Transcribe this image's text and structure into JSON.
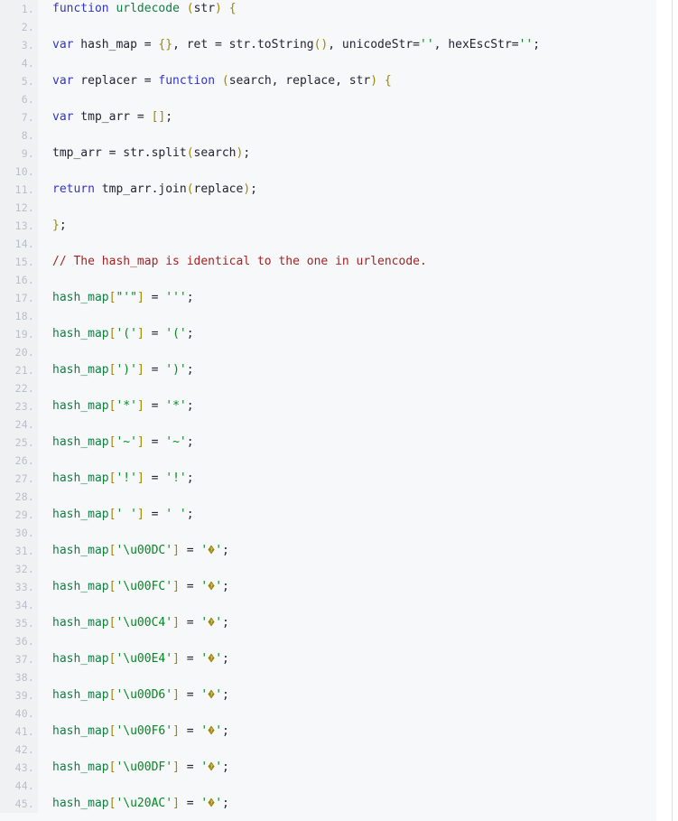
{
  "viewer": {
    "language": "javascript",
    "first_line": 1,
    "last_line": 45,
    "line_number_suffix": ".",
    "colors": {
      "gutter_background": "#f0f1f3",
      "gutter_text": "#b8bfcc",
      "code_background": "#f7f8fa",
      "plain_text": "#232333",
      "keyword": "#3333cc",
      "string": "#008a1f",
      "identifier": "#0f8040",
      "bracket": "#9b8800",
      "comment": "#a52222",
      "scrollbar_border": "#dcdcdc"
    }
  },
  "code": {
    "lines": [
      {
        "n": "1.",
        "tokens": [
          {
            "t": "kw",
            "v": "function"
          },
          {
            "t": "pl",
            "v": " "
          },
          {
            "t": "id",
            "v": "urldecode"
          },
          {
            "t": "pl",
            "v": " "
          },
          {
            "t": "brk",
            "v": "("
          },
          {
            "t": "pl",
            "v": "str"
          },
          {
            "t": "brk",
            "v": ")"
          },
          {
            "t": "pl",
            "v": " "
          },
          {
            "t": "brk",
            "v": "{"
          }
        ]
      },
      {
        "n": "2.",
        "tokens": []
      },
      {
        "n": "3.",
        "tokens": [
          {
            "t": "kw",
            "v": "var"
          },
          {
            "t": "pl",
            "v": " hash_map = "
          },
          {
            "t": "brk",
            "v": "{}"
          },
          {
            "t": "pl",
            "v": ", ret = str.toString"
          },
          {
            "t": "brk",
            "v": "()"
          },
          {
            "t": "pl",
            "v": ", unicodeStr="
          },
          {
            "t": "str",
            "v": "''"
          },
          {
            "t": "pl",
            "v": ", hexEscStr="
          },
          {
            "t": "str",
            "v": "''"
          },
          {
            "t": "pl",
            "v": ";"
          }
        ]
      },
      {
        "n": "4.",
        "tokens": []
      },
      {
        "n": "5.",
        "tokens": [
          {
            "t": "kw",
            "v": "var"
          },
          {
            "t": "pl",
            "v": " replacer = "
          },
          {
            "t": "kw",
            "v": "function"
          },
          {
            "t": "pl",
            "v": " "
          },
          {
            "t": "brk",
            "v": "("
          },
          {
            "t": "pl",
            "v": "search, replace, str"
          },
          {
            "t": "brk",
            "v": ")"
          },
          {
            "t": "pl",
            "v": " "
          },
          {
            "t": "brk",
            "v": "{"
          }
        ]
      },
      {
        "n": "6.",
        "tokens": []
      },
      {
        "n": "7.",
        "tokens": [
          {
            "t": "kw",
            "v": "var"
          },
          {
            "t": "pl",
            "v": " tmp_arr = "
          },
          {
            "t": "brk",
            "v": "[]"
          },
          {
            "t": "pl",
            "v": ";"
          }
        ]
      },
      {
        "n": "8.",
        "tokens": []
      },
      {
        "n": "9.",
        "tokens": [
          {
            "t": "pl",
            "v": "tmp_arr = str.split"
          },
          {
            "t": "brk",
            "v": "("
          },
          {
            "t": "pl",
            "v": "search"
          },
          {
            "t": "brk",
            "v": ")"
          },
          {
            "t": "pl",
            "v": ";"
          }
        ]
      },
      {
        "n": "10.",
        "tokens": []
      },
      {
        "n": "11.",
        "tokens": [
          {
            "t": "kw",
            "v": "return"
          },
          {
            "t": "pl",
            "v": " tmp_arr.join"
          },
          {
            "t": "brk",
            "v": "("
          },
          {
            "t": "pl",
            "v": "replace"
          },
          {
            "t": "brk",
            "v": ")"
          },
          {
            "t": "pl",
            "v": ";"
          }
        ]
      },
      {
        "n": "12.",
        "tokens": []
      },
      {
        "n": "13.",
        "tokens": [
          {
            "t": "brk",
            "v": "}"
          },
          {
            "t": "pl",
            "v": ";"
          }
        ]
      },
      {
        "n": "14.",
        "tokens": []
      },
      {
        "n": "15.",
        "tokens": [
          {
            "t": "com",
            "v": "// The hash_map is identical to the one in urlencode."
          }
        ]
      },
      {
        "n": "16.",
        "tokens": []
      },
      {
        "n": "17.",
        "tokens": [
          {
            "t": "id",
            "v": "hash_map"
          },
          {
            "t": "brk",
            "v": "["
          },
          {
            "t": "str",
            "v": "\"'\""
          },
          {
            "t": "brk",
            "v": "]"
          },
          {
            "t": "pl",
            "v": " = "
          },
          {
            "t": "str",
            "v": "'''"
          },
          {
            "t": "pl",
            "v": ";"
          }
        ]
      },
      {
        "n": "18.",
        "tokens": []
      },
      {
        "n": "19.",
        "tokens": [
          {
            "t": "id",
            "v": "hash_map"
          },
          {
            "t": "brk",
            "v": "["
          },
          {
            "t": "str",
            "v": "'('"
          },
          {
            "t": "brk",
            "v": "]"
          },
          {
            "t": "pl",
            "v": " = "
          },
          {
            "t": "str",
            "v": "'('"
          },
          {
            "t": "pl",
            "v": ";"
          }
        ]
      },
      {
        "n": "20.",
        "tokens": []
      },
      {
        "n": "21.",
        "tokens": [
          {
            "t": "id",
            "v": "hash_map"
          },
          {
            "t": "brk",
            "v": "["
          },
          {
            "t": "str",
            "v": "')'"
          },
          {
            "t": "brk",
            "v": "]"
          },
          {
            "t": "pl",
            "v": " = "
          },
          {
            "t": "str",
            "v": "')'"
          },
          {
            "t": "pl",
            "v": ";"
          }
        ]
      },
      {
        "n": "22.",
        "tokens": []
      },
      {
        "n": "23.",
        "tokens": [
          {
            "t": "id",
            "v": "hash_map"
          },
          {
            "t": "brk",
            "v": "["
          },
          {
            "t": "str",
            "v": "'*'"
          },
          {
            "t": "brk",
            "v": "]"
          },
          {
            "t": "pl",
            "v": " = "
          },
          {
            "t": "str",
            "v": "'*'"
          },
          {
            "t": "pl",
            "v": ";"
          }
        ]
      },
      {
        "n": "24.",
        "tokens": []
      },
      {
        "n": "25.",
        "tokens": [
          {
            "t": "id",
            "v": "hash_map"
          },
          {
            "t": "brk",
            "v": "["
          },
          {
            "t": "str",
            "v": "'~'"
          },
          {
            "t": "brk",
            "v": "]"
          },
          {
            "t": "pl",
            "v": " = "
          },
          {
            "t": "str",
            "v": "'~'"
          },
          {
            "t": "pl",
            "v": ";"
          }
        ]
      },
      {
        "n": "26.",
        "tokens": []
      },
      {
        "n": "27.",
        "tokens": [
          {
            "t": "id",
            "v": "hash_map"
          },
          {
            "t": "brk",
            "v": "["
          },
          {
            "t": "str",
            "v": "'!'"
          },
          {
            "t": "brk",
            "v": "]"
          },
          {
            "t": "pl",
            "v": " = "
          },
          {
            "t": "str",
            "v": "'!'"
          },
          {
            "t": "pl",
            "v": ";"
          }
        ]
      },
      {
        "n": "28.",
        "tokens": []
      },
      {
        "n": "29.",
        "tokens": [
          {
            "t": "id",
            "v": "hash_map"
          },
          {
            "t": "brk",
            "v": "["
          },
          {
            "t": "str",
            "v": "' '"
          },
          {
            "t": "brk",
            "v": "]"
          },
          {
            "t": "pl",
            "v": " = "
          },
          {
            "t": "str",
            "v": "' '"
          },
          {
            "t": "pl",
            "v": ";"
          }
        ]
      },
      {
        "n": "30.",
        "tokens": []
      },
      {
        "n": "31.",
        "tokens": [
          {
            "t": "id",
            "v": "hash_map"
          },
          {
            "t": "brk",
            "v": "["
          },
          {
            "t": "str",
            "v": "'\\u00DC'"
          },
          {
            "t": "brk",
            "v": "]"
          },
          {
            "t": "pl",
            "v": " = "
          },
          {
            "t": "str",
            "v": "'"
          },
          {
            "t": "repl",
            "v": "�"
          },
          {
            "t": "str",
            "v": "'"
          },
          {
            "t": "pl",
            "v": ";"
          }
        ]
      },
      {
        "n": "32.",
        "tokens": []
      },
      {
        "n": "33.",
        "tokens": [
          {
            "t": "id",
            "v": "hash_map"
          },
          {
            "t": "brk",
            "v": "["
          },
          {
            "t": "str",
            "v": "'\\u00FC'"
          },
          {
            "t": "brk",
            "v": "]"
          },
          {
            "t": "pl",
            "v": " = "
          },
          {
            "t": "str",
            "v": "'"
          },
          {
            "t": "repl",
            "v": "�"
          },
          {
            "t": "str",
            "v": "'"
          },
          {
            "t": "pl",
            "v": ";"
          }
        ]
      },
      {
        "n": "34.",
        "tokens": []
      },
      {
        "n": "35.",
        "tokens": [
          {
            "t": "id",
            "v": "hash_map"
          },
          {
            "t": "brk",
            "v": "["
          },
          {
            "t": "str",
            "v": "'\\u00C4'"
          },
          {
            "t": "brk",
            "v": "]"
          },
          {
            "t": "pl",
            "v": " = "
          },
          {
            "t": "str",
            "v": "'"
          },
          {
            "t": "repl",
            "v": "�"
          },
          {
            "t": "str",
            "v": "'"
          },
          {
            "t": "pl",
            "v": ";"
          }
        ]
      },
      {
        "n": "36.",
        "tokens": []
      },
      {
        "n": "37.",
        "tokens": [
          {
            "t": "id",
            "v": "hash_map"
          },
          {
            "t": "brk",
            "v": "["
          },
          {
            "t": "str",
            "v": "'\\u00E4'"
          },
          {
            "t": "brk",
            "v": "]"
          },
          {
            "t": "pl",
            "v": " = "
          },
          {
            "t": "str",
            "v": "'"
          },
          {
            "t": "repl",
            "v": "�"
          },
          {
            "t": "str",
            "v": "'"
          },
          {
            "t": "pl",
            "v": ";"
          }
        ]
      },
      {
        "n": "38.",
        "tokens": []
      },
      {
        "n": "39.",
        "tokens": [
          {
            "t": "id",
            "v": "hash_map"
          },
          {
            "t": "brk",
            "v": "["
          },
          {
            "t": "str",
            "v": "'\\u00D6'"
          },
          {
            "t": "brk",
            "v": "]"
          },
          {
            "t": "pl",
            "v": " = "
          },
          {
            "t": "str",
            "v": "'"
          },
          {
            "t": "repl",
            "v": "�"
          },
          {
            "t": "str",
            "v": "'"
          },
          {
            "t": "pl",
            "v": ";"
          }
        ]
      },
      {
        "n": "40.",
        "tokens": []
      },
      {
        "n": "41.",
        "tokens": [
          {
            "t": "id",
            "v": "hash_map"
          },
          {
            "t": "brk",
            "v": "["
          },
          {
            "t": "str",
            "v": "'\\u00F6'"
          },
          {
            "t": "brk",
            "v": "]"
          },
          {
            "t": "pl",
            "v": " = "
          },
          {
            "t": "str",
            "v": "'"
          },
          {
            "t": "repl",
            "v": "�"
          },
          {
            "t": "str",
            "v": "'"
          },
          {
            "t": "pl",
            "v": ";"
          }
        ]
      },
      {
        "n": "42.",
        "tokens": []
      },
      {
        "n": "43.",
        "tokens": [
          {
            "t": "id",
            "v": "hash_map"
          },
          {
            "t": "brk",
            "v": "["
          },
          {
            "t": "str",
            "v": "'\\u00DF'"
          },
          {
            "t": "brk",
            "v": "]"
          },
          {
            "t": "pl",
            "v": " = "
          },
          {
            "t": "str",
            "v": "'"
          },
          {
            "t": "repl",
            "v": "�"
          },
          {
            "t": "str",
            "v": "'"
          },
          {
            "t": "pl",
            "v": ";"
          }
        ]
      },
      {
        "n": "44.",
        "tokens": []
      },
      {
        "n": "45.",
        "tokens": [
          {
            "t": "id",
            "v": "hash_map"
          },
          {
            "t": "brk",
            "v": "["
          },
          {
            "t": "str",
            "v": "'\\u20AC'"
          },
          {
            "t": "brk",
            "v": "]"
          },
          {
            "t": "pl",
            "v": " = "
          },
          {
            "t": "str",
            "v": "'"
          },
          {
            "t": "repl",
            "v": "�"
          },
          {
            "t": "str",
            "v": "'"
          },
          {
            "t": "pl",
            "v": ";"
          }
        ]
      }
    ]
  }
}
